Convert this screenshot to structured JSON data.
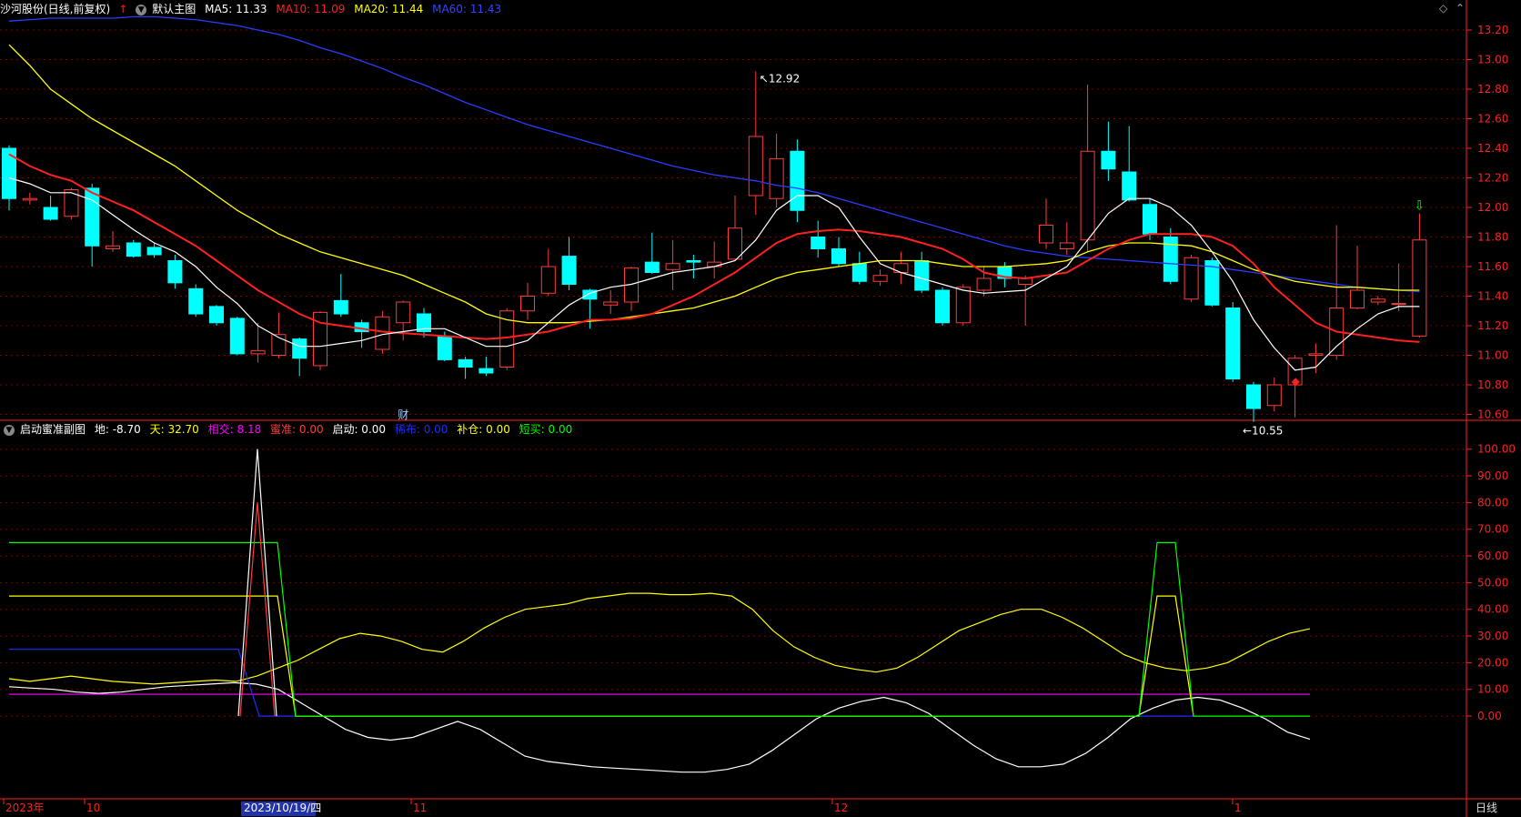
{
  "main_header": {
    "stock": "沙河股份(日线,前复权)",
    "template": "默认主图",
    "ma5": "MA5: 11.33",
    "ma10": "MA10: 11.09",
    "ma20": "MA20: 11.44",
    "ma60": "MA60: 11.43"
  },
  "sub_header": {
    "name": "启动蜜准副图",
    "di": "地: -8.70",
    "tian": "天: 32.70",
    "xiangjiao": "相交: 8.18",
    "mizhun": "蜜准: 0.00",
    "qidong": "启动: 0.00",
    "xibu": "稀布: 0.00",
    "buhe": "补仓: 0.00",
    "duanmai": "短买: 0.00"
  },
  "colors": {
    "up": "#ff3b3b",
    "down": "#00ffff",
    "ma5": "#ffffff",
    "ma10": "#ff2020",
    "ma20": "#ffff00",
    "ma60": "#2a3cff",
    "grid": "#7a0000",
    "axis": "#ff2020",
    "di": "#ffffff",
    "tian": "#ffff00",
    "xiangjiao": "#ff00ff",
    "mizhun": "#ff3b3b",
    "qidong": "#ffffff",
    "xibu": "#1e2cff",
    "buhe": "#ffff00",
    "duanmai": "#00ff00"
  },
  "labels": {
    "high_label": "12.92",
    "low_label": "10.55",
    "cai_marker": "财",
    "period": "日线"
  },
  "chart_data": [
    {
      "type": "candlestick",
      "title": "沙河股份(日线,前复权)",
      "y_ticks": [
        "13.20",
        "13.00",
        "12.80",
        "12.60",
        "12.40",
        "12.20",
        "12.00",
        "11.80",
        "11.60",
        "11.40",
        "11.20",
        "11.00",
        "10.80",
        "10.60"
      ],
      "ylim": [
        10.56,
        13.28
      ],
      "candles": [
        {
          "o": 12.4,
          "h": 12.42,
          "l": 11.98,
          "c": 12.06
        },
        {
          "o": 12.05,
          "h": 12.1,
          "l": 12.02,
          "c": 12.06
        },
        {
          "o": 12.0,
          "h": 12.08,
          "l": 11.91,
          "c": 11.92
        },
        {
          "o": 11.94,
          "h": 12.13,
          "l": 11.92,
          "c": 12.12
        },
        {
          "o": 12.13,
          "h": 12.16,
          "l": 11.6,
          "c": 11.74
        },
        {
          "o": 11.72,
          "h": 11.84,
          "l": 11.7,
          "c": 11.74
        },
        {
          "o": 11.76,
          "h": 11.78,
          "l": 11.66,
          "c": 11.67
        },
        {
          "o": 11.73,
          "h": 11.76,
          "l": 11.66,
          "c": 11.68
        },
        {
          "o": 11.64,
          "h": 11.68,
          "l": 11.45,
          "c": 11.49
        },
        {
          "o": 11.45,
          "h": 11.48,
          "l": 11.26,
          "c": 11.28
        },
        {
          "o": 11.33,
          "h": 11.34,
          "l": 11.2,
          "c": 11.22
        },
        {
          "o": 11.25,
          "h": 11.26,
          "l": 11.0,
          "c": 11.01
        },
        {
          "o": 11.01,
          "h": 11.22,
          "l": 10.95,
          "c": 11.03
        },
        {
          "o": 11.0,
          "h": 11.29,
          "l": 10.98,
          "c": 11.14
        },
        {
          "o": 11.11,
          "h": 11.12,
          "l": 10.86,
          "c": 10.98
        },
        {
          "o": 10.93,
          "h": 11.3,
          "l": 10.9,
          "c": 11.29
        },
        {
          "o": 11.37,
          "h": 11.55,
          "l": 11.26,
          "c": 11.28
        },
        {
          "o": 11.22,
          "h": 11.24,
          "l": 11.05,
          "c": 11.16
        },
        {
          "o": 11.04,
          "h": 11.3,
          "l": 11.01,
          "c": 11.26
        },
        {
          "o": 11.22,
          "h": 11.37,
          "l": 11.1,
          "c": 11.36
        },
        {
          "o": 11.28,
          "h": 11.32,
          "l": 11.12,
          "c": 11.16
        },
        {
          "o": 11.13,
          "h": 11.16,
          "l": 10.96,
          "c": 10.97
        },
        {
          "o": 10.97,
          "h": 10.99,
          "l": 10.84,
          "c": 10.92
        },
        {
          "o": 10.91,
          "h": 10.99,
          "l": 10.86,
          "c": 10.88
        },
        {
          "o": 10.92,
          "h": 11.32,
          "l": 10.9,
          "c": 11.3
        },
        {
          "o": 11.3,
          "h": 11.49,
          "l": 11.24,
          "c": 11.4
        },
        {
          "o": 11.42,
          "h": 11.72,
          "l": 11.4,
          "c": 11.6
        },
        {
          "o": 11.67,
          "h": 11.8,
          "l": 11.44,
          "c": 11.48
        },
        {
          "o": 11.44,
          "h": 11.45,
          "l": 11.18,
          "c": 11.38
        },
        {
          "o": 11.34,
          "h": 11.44,
          "l": 11.28,
          "c": 11.36
        },
        {
          "o": 11.36,
          "h": 11.6,
          "l": 11.3,
          "c": 11.59
        },
        {
          "o": 11.63,
          "h": 11.83,
          "l": 11.55,
          "c": 11.56
        },
        {
          "o": 11.58,
          "h": 11.78,
          "l": 11.44,
          "c": 11.62
        },
        {
          "o": 11.64,
          "h": 11.68,
          "l": 11.52,
          "c": 11.63
        },
        {
          "o": 11.6,
          "h": 11.77,
          "l": 11.52,
          "c": 11.63
        },
        {
          "o": 11.65,
          "h": 12.08,
          "l": 11.64,
          "c": 11.86
        },
        {
          "o": 12.08,
          "h": 12.92,
          "l": 11.95,
          "c": 12.48
        },
        {
          "o": 12.06,
          "h": 12.5,
          "l": 12.0,
          "c": 12.33
        },
        {
          "o": 12.38,
          "h": 12.46,
          "l": 11.9,
          "c": 11.98
        },
        {
          "o": 11.8,
          "h": 11.91,
          "l": 11.66,
          "c": 11.72
        },
        {
          "o": 11.72,
          "h": 11.8,
          "l": 11.6,
          "c": 11.62
        },
        {
          "o": 11.62,
          "h": 11.7,
          "l": 11.48,
          "c": 11.5
        },
        {
          "o": 11.5,
          "h": 11.58,
          "l": 11.47,
          "c": 11.54
        },
        {
          "o": 11.56,
          "h": 11.7,
          "l": 11.48,
          "c": 11.62
        },
        {
          "o": 11.64,
          "h": 11.7,
          "l": 11.42,
          "c": 11.44
        },
        {
          "o": 11.44,
          "h": 11.46,
          "l": 11.2,
          "c": 11.22
        },
        {
          "o": 11.22,
          "h": 11.48,
          "l": 11.2,
          "c": 11.46
        },
        {
          "o": 11.44,
          "h": 11.6,
          "l": 11.4,
          "c": 11.52
        },
        {
          "o": 11.6,
          "h": 11.63,
          "l": 11.46,
          "c": 11.52
        },
        {
          "o": 11.48,
          "h": 11.54,
          "l": 11.2,
          "c": 11.52
        },
        {
          "o": 11.76,
          "h": 12.06,
          "l": 11.72,
          "c": 11.88
        },
        {
          "o": 11.72,
          "h": 11.9,
          "l": 11.68,
          "c": 11.76
        },
        {
          "o": 11.78,
          "h": 12.83,
          "l": 11.7,
          "c": 12.38
        },
        {
          "o": 12.38,
          "h": 12.58,
          "l": 12.18,
          "c": 12.26
        },
        {
          "o": 12.24,
          "h": 12.55,
          "l": 12.04,
          "c": 12.05
        },
        {
          "o": 12.02,
          "h": 12.06,
          "l": 11.78,
          "c": 11.82
        },
        {
          "o": 11.8,
          "h": 11.86,
          "l": 11.48,
          "c": 11.5
        },
        {
          "o": 11.38,
          "h": 11.68,
          "l": 11.36,
          "c": 11.66
        },
        {
          "o": 11.64,
          "h": 11.66,
          "l": 11.33,
          "c": 11.34
        },
        {
          "o": 11.32,
          "h": 11.36,
          "l": 10.82,
          "c": 10.84
        },
        {
          "o": 10.8,
          "h": 10.82,
          "l": 10.55,
          "c": 10.64
        },
        {
          "o": 10.66,
          "h": 10.85,
          "l": 10.62,
          "c": 10.8
        },
        {
          "o": 10.8,
          "h": 11.0,
          "l": 10.58,
          "c": 10.98
        },
        {
          "o": 11.0,
          "h": 11.08,
          "l": 10.88,
          "c": 11.01
        },
        {
          "o": 11.0,
          "h": 11.88,
          "l": 10.97,
          "c": 11.32
        },
        {
          "o": 11.32,
          "h": 11.74,
          "l": 11.31,
          "c": 11.44
        },
        {
          "o": 11.36,
          "h": 11.4,
          "l": 11.34,
          "c": 11.38
        },
        {
          "o": 11.35,
          "h": 11.62,
          "l": 11.3,
          "c": 11.35
        },
        {
          "o": 11.13,
          "h": 11.96,
          "l": 11.12,
          "c": 11.78
        }
      ],
      "ma5": [
        12.2,
        12.16,
        12.1,
        12.1,
        12.05,
        11.95,
        11.85,
        11.76,
        11.7,
        11.6,
        11.46,
        11.35,
        11.2,
        11.12,
        11.06,
        11.06,
        11.08,
        11.1,
        11.14,
        11.16,
        11.18,
        11.18,
        11.12,
        11.06,
        11.06,
        11.1,
        11.22,
        11.34,
        11.42,
        11.46,
        11.48,
        11.52,
        11.56,
        11.58,
        11.6,
        11.64,
        11.78,
        11.98,
        12.08,
        12.08,
        12.0,
        11.8,
        11.62,
        11.56,
        11.52,
        11.48,
        11.44,
        11.42,
        11.43,
        11.44,
        11.52,
        11.6,
        11.78,
        11.96,
        12.06,
        12.06,
        12.0,
        11.88,
        11.7,
        11.5,
        11.24,
        11.05,
        10.9,
        10.92,
        11.06,
        11.18,
        11.28,
        11.33,
        11.33
      ],
      "ma10": [
        12.36,
        12.28,
        12.22,
        12.18,
        12.1,
        12.04,
        11.98,
        11.9,
        11.82,
        11.74,
        11.64,
        11.54,
        11.44,
        11.36,
        11.28,
        11.22,
        11.2,
        11.18,
        11.16,
        11.15,
        11.14,
        11.13,
        11.12,
        11.11,
        11.12,
        11.14,
        11.16,
        11.2,
        11.24,
        11.24,
        11.25,
        11.28,
        11.34,
        11.4,
        11.48,
        11.56,
        11.66,
        11.76,
        11.82,
        11.84,
        11.85,
        11.84,
        11.82,
        11.8,
        11.76,
        11.72,
        11.65,
        11.56,
        11.53,
        11.52,
        11.54,
        11.56,
        11.64,
        11.72,
        11.78,
        11.82,
        11.82,
        11.82,
        11.8,
        11.74,
        11.62,
        11.46,
        11.34,
        11.22,
        11.16,
        11.14,
        11.12,
        11.1,
        11.09
      ],
      "ma20": [
        13.1,
        12.96,
        12.8,
        12.7,
        12.6,
        12.52,
        12.44,
        12.36,
        12.28,
        12.18,
        12.08,
        11.98,
        11.9,
        11.82,
        11.76,
        11.7,
        11.66,
        11.62,
        11.58,
        11.54,
        11.48,
        11.42,
        11.36,
        11.28,
        11.24,
        11.22,
        11.22,
        11.22,
        11.23,
        11.24,
        11.26,
        11.28,
        11.3,
        11.32,
        11.36,
        11.4,
        11.46,
        11.52,
        11.56,
        11.58,
        11.6,
        11.62,
        11.64,
        11.64,
        11.64,
        11.62,
        11.6,
        11.6,
        11.6,
        11.61,
        11.62,
        11.64,
        11.7,
        11.74,
        11.76,
        11.76,
        11.75,
        11.74,
        11.7,
        11.64,
        11.58,
        11.54,
        11.5,
        11.48,
        11.46,
        11.46,
        11.45,
        11.44,
        11.44
      ],
      "ma60": [
        13.26,
        13.27,
        13.28,
        13.28,
        13.28,
        13.28,
        13.29,
        13.29,
        13.28,
        13.27,
        13.25,
        13.23,
        13.2,
        13.17,
        13.13,
        13.08,
        13.04,
        12.99,
        12.94,
        12.88,
        12.83,
        12.77,
        12.71,
        12.66,
        12.61,
        12.56,
        12.52,
        12.48,
        12.44,
        12.4,
        12.36,
        12.32,
        12.28,
        12.25,
        12.22,
        12.2,
        12.18,
        12.15,
        12.13,
        12.1,
        12.06,
        12.02,
        11.98,
        11.94,
        11.9,
        11.86,
        11.82,
        11.78,
        11.74,
        11.71,
        11.69,
        11.67,
        11.66,
        11.65,
        11.64,
        11.63,
        11.62,
        11.61,
        11.6,
        11.58,
        11.56,
        11.54,
        11.52,
        11.5,
        11.48,
        11.46,
        11.45,
        11.44,
        11.43
      ]
    },
    {
      "type": "line",
      "title": "启动蜜准副图",
      "y_ticks": [
        "100.00",
        "90.00",
        "80.00",
        "70.00",
        "60.00",
        "50.00",
        "40.00",
        "30.00",
        "20.00",
        "10.00",
        "0.00"
      ],
      "ylim": [
        -31,
        104
      ],
      "series": [
        {
          "name": "地",
          "values": [
            11,
            10.5,
            10,
            9,
            8.5,
            9,
            10,
            11,
            11.5,
            12,
            12.5,
            12,
            10,
            5,
            0,
            -5,
            -8,
            -9,
            -8,
            -5,
            -2,
            -5,
            -10,
            -15,
            -17,
            -18,
            -19,
            -19.5,
            -20,
            -20.5,
            -21,
            -21,
            -20,
            -18,
            -13,
            -7,
            -1,
            3,
            5.5,
            7,
            5,
            1,
            -5,
            -11,
            -16,
            -19,
            -19,
            -18,
            -14,
            -8,
            -1,
            3,
            6,
            7,
            6,
            3,
            -1,
            -6,
            -8.7
          ]
        },
        {
          "name": "天",
          "values": [
            14,
            13,
            14,
            15,
            14,
            13,
            12.5,
            12,
            12.5,
            13,
            13.5,
            13,
            15,
            18,
            21,
            25,
            29,
            31,
            30,
            28,
            25,
            24,
            28,
            33,
            37,
            40,
            41,
            42,
            44,
            45,
            46,
            46,
            45.5,
            45.5,
            46,
            45,
            40,
            32,
            26,
            22,
            19,
            17.5,
            16.5,
            18,
            22,
            27,
            32,
            35,
            38,
            40,
            40,
            37,
            33,
            28,
            23,
            20,
            18,
            17,
            18,
            20,
            24,
            28,
            31,
            32.7
          ]
        },
        {
          "name": "相交",
          "values": [
            8.18
          ]
        },
        {
          "name": "启动",
          "values": [
            0,
            100,
            0
          ]
        },
        {
          "name": "蜜准",
          "values": [
            0,
            80,
            0
          ]
        },
        {
          "name": "稀布",
          "values": [
            25,
            25,
            0,
            0
          ]
        },
        {
          "name": "补仓",
          "values": [
            45,
            45,
            0,
            0,
            45,
            45,
            0
          ]
        },
        {
          "name": "短买",
          "values": [
            65,
            65,
            0,
            0,
            65,
            65,
            0
          ]
        }
      ]
    }
  ],
  "axis": {
    "year_label": "2023年",
    "m10": "10",
    "date_label": "2023/10/19/四",
    "m11": "11",
    "m12": "12",
    "m1": "1"
  }
}
